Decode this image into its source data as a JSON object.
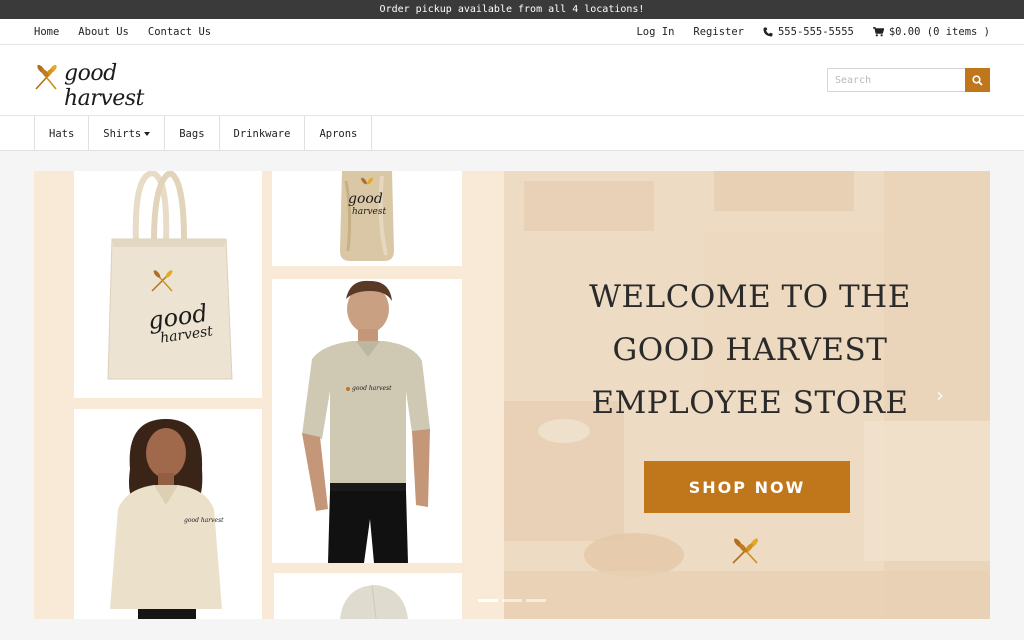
{
  "announcement": "Order pickup available from all 4 locations!",
  "topnav": {
    "left": [
      "Home",
      "About Us",
      "Contact Us"
    ],
    "login": "Log In",
    "register": "Register",
    "phone": "555-555-5555",
    "cart": "$0.00 (0 items )"
  },
  "brand": {
    "name": "good harvest"
  },
  "search": {
    "placeholder": "Search"
  },
  "categories": [
    "Hats",
    "Shirts",
    "Bags",
    "Drinkware",
    "Aprons"
  ],
  "hero": {
    "headline_lines": [
      "WELCOME TO THE",
      "GOOD HARVEST",
      "EMPLOYEE STORE"
    ],
    "cta": "SHOP NOW",
    "product_logo": {
      "line1": "good",
      "line2": "harvest"
    },
    "shirt_logo": "good harvest",
    "slides_count": 3,
    "active_slide": 0
  },
  "colors": {
    "accent": "#c0771c",
    "announce_bg": "#3a3a3a",
    "hero_bg": "#f9ead7"
  },
  "icons": [
    "wheat-logo-icon",
    "search-icon",
    "phone-icon",
    "cart-icon",
    "chevron-down-icon",
    "chevron-right-icon"
  ]
}
